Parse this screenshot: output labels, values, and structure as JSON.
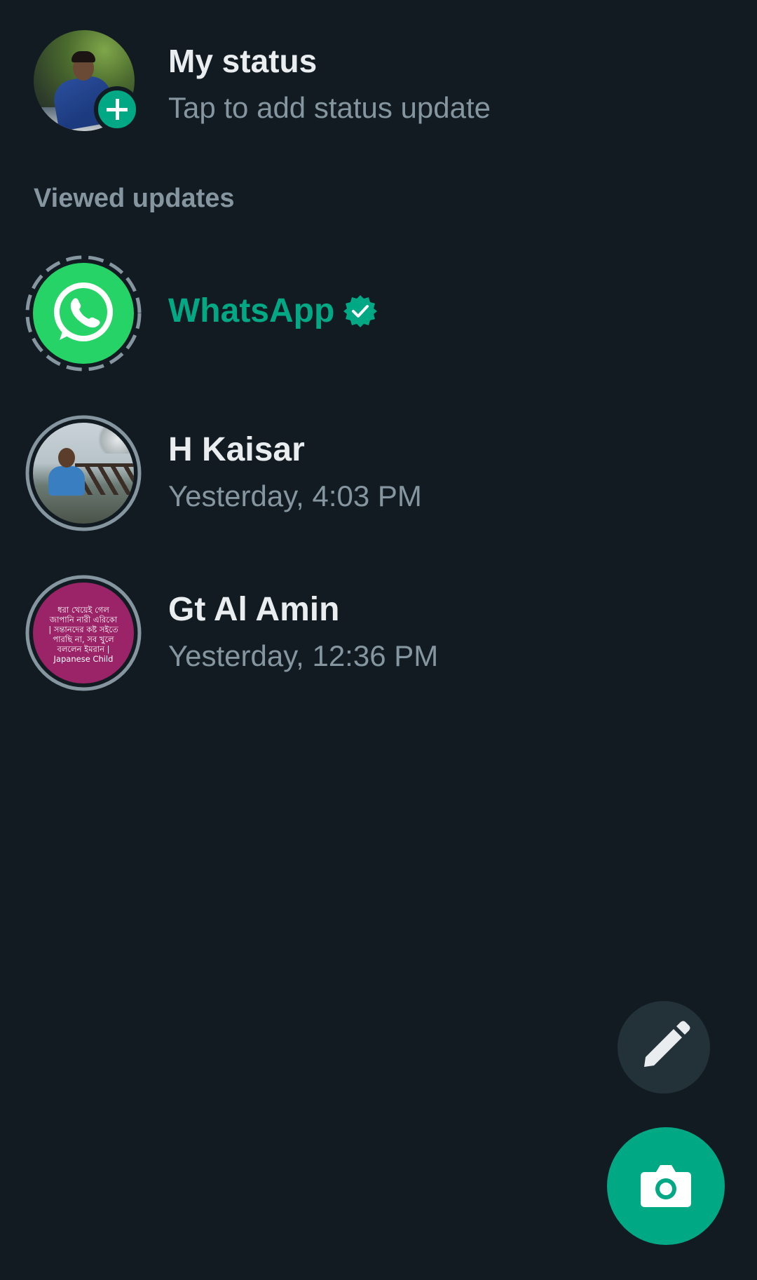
{
  "my_status": {
    "title": "My status",
    "subtitle": "Tap to add status update"
  },
  "viewed_header": "Viewed updates",
  "statuses": [
    {
      "name": "WhatsApp",
      "verified": true,
      "time": ""
    },
    {
      "name": "H Kaisar",
      "time": "Yesterday, 4:03 PM"
    },
    {
      "name": "Gt Al Amin",
      "time": "Yesterday, 12:36 PM",
      "thumb_text": "ধরা খেয়েই গেল\nজাপানি নারী এরিকো\n| সন্তানদের কষ্ট সইতে\nপারছি না, সব খুলে\nবললেন ইমরান |\nJapanese Child"
    }
  ],
  "colors": {
    "background": "#121b22",
    "accent": "#00a884",
    "whatsapp_green": "#25d366",
    "secondary_text": "#8696a0",
    "fab_secondary": "#233138"
  },
  "icons": [
    "plus-icon",
    "whatsapp-icon",
    "verified-icon",
    "pencil-icon",
    "camera-icon"
  ]
}
